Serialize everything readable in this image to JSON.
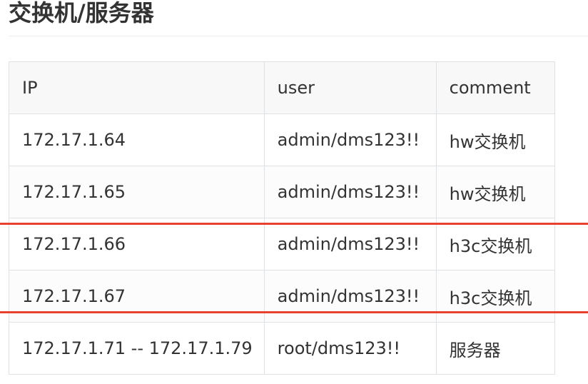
{
  "page": {
    "title": "交换机/服务器"
  },
  "table": {
    "headers": [
      "IP",
      "user",
      "comment"
    ],
    "rows": [
      [
        "172.17.1.64",
        "admin/dms123!!",
        "hw交换机"
      ],
      [
        "172.17.1.65",
        "admin/dms123!!",
        "hw交换机"
      ],
      [
        "172.17.1.66",
        "admin/dms123!!",
        "h3c交换机"
      ],
      [
        "172.17.1.67",
        "admin/dms123!!",
        "h3c交换机"
      ],
      [
        "172.17.1.71 -- 172.17.1.79",
        "root/dms123!!",
        "服务器"
      ]
    ]
  },
  "annotations": {
    "highlight_color": "#e8422f"
  }
}
